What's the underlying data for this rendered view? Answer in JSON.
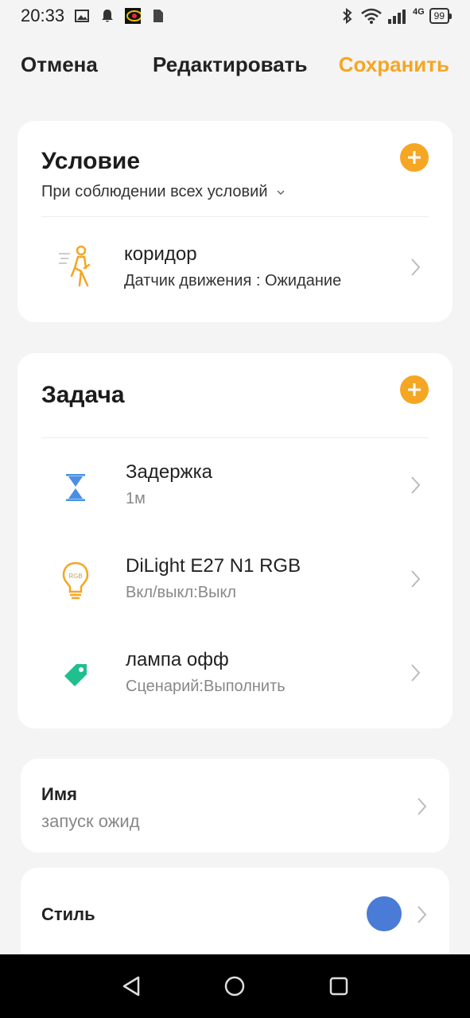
{
  "status_bar": {
    "time": "20:33",
    "network": "4G",
    "battery": "99"
  },
  "header": {
    "cancel_label": "Отмена",
    "title": "Редактировать",
    "save_label": "Сохранить"
  },
  "condition": {
    "title": "Условие",
    "mode": "При соблюдении всех условий",
    "items": [
      {
        "name": "коридор",
        "detail": "Датчик движения : Ожидание",
        "icon": "motion-sensor-icon"
      }
    ]
  },
  "task": {
    "title": "Задача",
    "items": [
      {
        "name": "Задержка",
        "detail": "1м",
        "icon": "hourglass-icon"
      },
      {
        "name": "DiLight E27 N1 RGB",
        "detail": "Вкл/выкл:Выкл",
        "icon": "rgb-bulb-icon",
        "icon_text": "RGB"
      },
      {
        "name": "лампа офф",
        "detail": "Сценарий:Выполнить",
        "icon": "tag-icon"
      }
    ]
  },
  "name_section": {
    "label": "Имя",
    "value": "запуск ожид"
  },
  "style_section": {
    "label": "Стиль",
    "color": "#4a7bd6"
  },
  "colors": {
    "accent": "#f5a623"
  }
}
